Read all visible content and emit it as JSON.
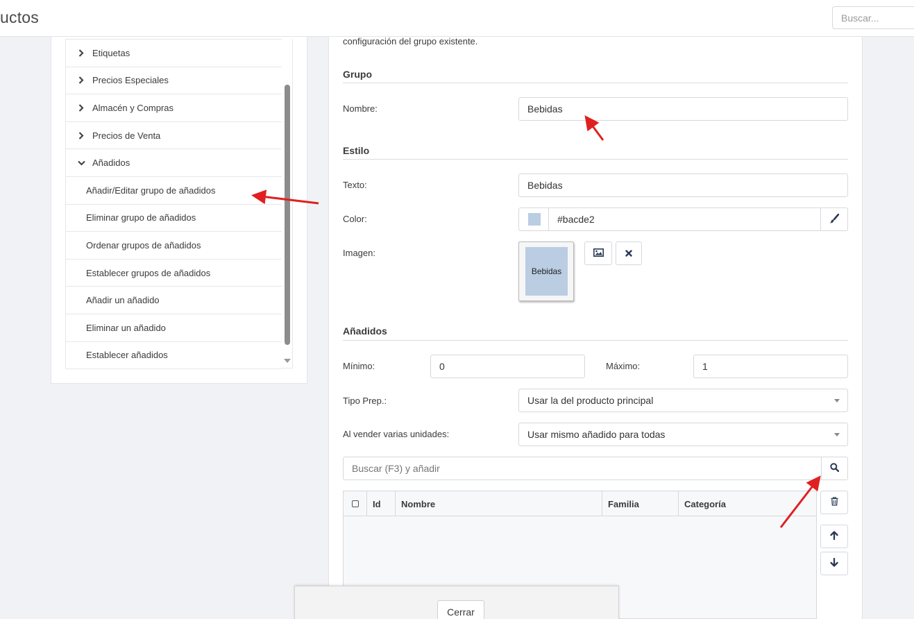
{
  "header": {
    "title": "uctos",
    "search_placeholder": "Buscar..."
  },
  "menu": {
    "items": [
      {
        "label": "Etiquetas",
        "type": "collapsed"
      },
      {
        "label": "Precios Especiales",
        "type": "collapsed"
      },
      {
        "label": "Almacén y Compras",
        "type": "collapsed"
      },
      {
        "label": "Precios de Venta",
        "type": "collapsed"
      },
      {
        "label": "Añadidos",
        "type": "expanded"
      },
      {
        "label": "Añadir/Editar grupo de añadidos",
        "type": "sub"
      },
      {
        "label": "Eliminar grupo de añadidos",
        "type": "sub"
      },
      {
        "label": "Ordenar grupos de añadidos",
        "type": "sub"
      },
      {
        "label": "Establecer grupos de añadidos",
        "type": "sub"
      },
      {
        "label": "Añadir un añadido",
        "type": "sub"
      },
      {
        "label": "Eliminar un añadido",
        "type": "sub"
      },
      {
        "label": "Establecer añadidos",
        "type": "sub"
      }
    ]
  },
  "form": {
    "intro": "configuración del grupo existente.",
    "grupo": {
      "section": "Grupo",
      "nombre_label": "Nombre:",
      "nombre_value": "Bebidas"
    },
    "estilo": {
      "section": "Estilo",
      "texto_label": "Texto:",
      "texto_value": "Bebidas",
      "color_label": "Color:",
      "color_value": "#bacde2",
      "imagen_label": "Imagen:",
      "imagen_text": "Bebidas"
    },
    "anadidos": {
      "section": "Añadidos",
      "minimo_label": "Mínimo:",
      "minimo_value": "0",
      "maximo_label": "Máximo:",
      "maximo_value": "1",
      "tipo_prep_label": "Tipo Prep.:",
      "tipo_prep_value": "Usar la del producto principal",
      "varias_label": "Al vender varias unidades:",
      "varias_value": "Usar mismo añadido para todas",
      "search_placeholder": "Buscar (F3) y añadir"
    }
  },
  "table": {
    "columns": [
      "Id",
      "Nombre",
      "Familia",
      "Categoría"
    ]
  },
  "dialog": {
    "close_label": "Cerrar"
  },
  "colors": {
    "swatch": "#bacde2",
    "annotation_arrow": "#e02020",
    "icon_dark": "#2b3a55"
  },
  "icons": [
    "chevron-right-icon",
    "chevron-down-icon",
    "brush-icon",
    "image-icon",
    "close-icon",
    "search-icon",
    "trash-icon",
    "arrow-up-icon",
    "arrow-down-icon"
  ]
}
